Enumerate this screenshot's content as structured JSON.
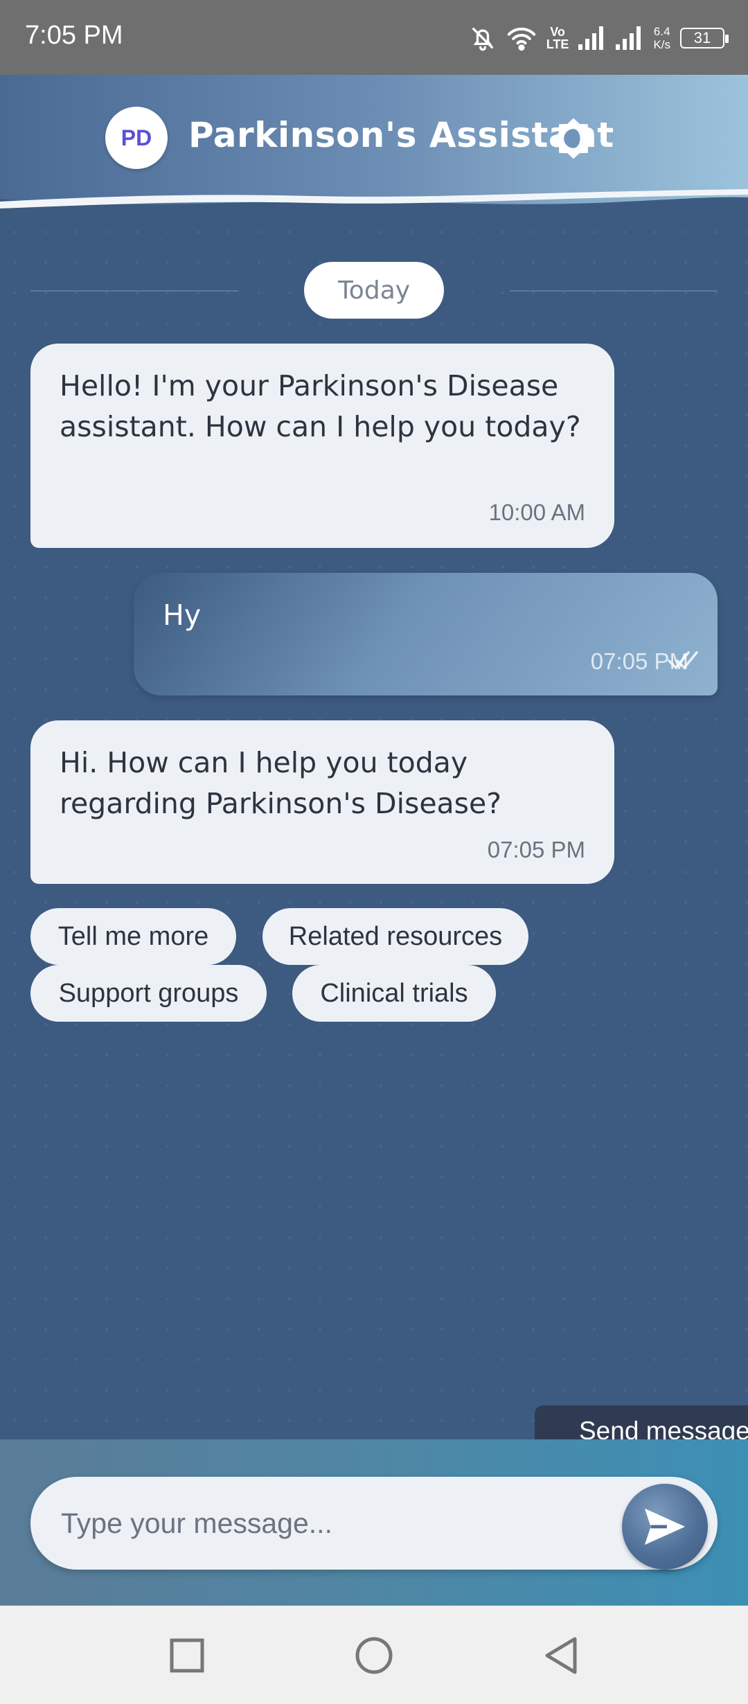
{
  "status_bar": {
    "time": "7:05 PM",
    "network_type_top": "Vo",
    "network_type_bottom": "LTE",
    "speed_top": "6.4",
    "speed_bottom": "K/s",
    "battery": "31",
    "icons": [
      "bell-off-icon",
      "wifi-icon",
      "signal-icon",
      "signal-icon",
      "battery-icon"
    ]
  },
  "header": {
    "logo_text": "PD",
    "title": "Parkinson's Assistant",
    "theme_toggle_icon": "brightness-icon"
  },
  "chat": {
    "date_label": "Today",
    "messages": [
      {
        "sender": "bot",
        "text": "Hello! I'm your Parkinson's Disease assistant. How can I help you today?",
        "time": "10:00 AM"
      },
      {
        "sender": "user",
        "text": "Hy",
        "time": "07:05 PM",
        "status_icon": "double-check-icon"
      },
      {
        "sender": "bot",
        "text": "Hi. How can I help you today regarding Parkinson's Disease?",
        "time": "07:05 PM"
      }
    ],
    "quick_replies": [
      "Tell me more",
      "Related resources",
      "Support groups",
      "Clinical trials"
    ]
  },
  "tooltip": {
    "text": "Send message"
  },
  "composer": {
    "placeholder": "Type your message...",
    "value": "",
    "send_icon": "send-icon"
  },
  "nav": {
    "icons": [
      "recents-square-icon",
      "home-circle-icon",
      "back-triangle-icon"
    ]
  },
  "colors": {
    "chat_background": "#3d5a80",
    "bubble_bot": "#edf1f6",
    "logo_text": "#5b4fd6",
    "tooltip": "#2e3b52"
  }
}
